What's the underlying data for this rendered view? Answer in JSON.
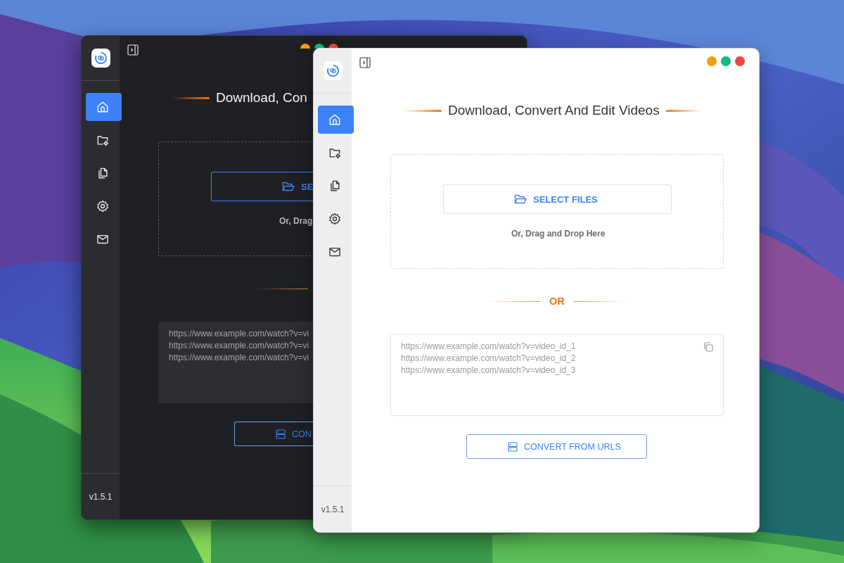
{
  "windows": [
    {
      "dark": true,
      "controls": [
        {
          "color": "#f59e0b"
        },
        {
          "color": "#10b981"
        },
        {
          "color": "#ef4444"
        }
      ],
      "sidebar": {
        "items": [
          {
            "kind": "home",
            "selected": true
          },
          {
            "kind": "folder-settings",
            "selected": false
          },
          {
            "kind": "files",
            "selected": false
          },
          {
            "kind": "settings",
            "selected": false
          },
          {
            "kind": "mail",
            "selected": false
          }
        ],
        "version": "v1.5.1"
      },
      "heading": "Download, Con",
      "select_button": "SE",
      "drop_hint": "Or, Drag",
      "urls": [
        "https://www.example.com/watch?v=vi",
        "https://www.example.com/watch?v=vi",
        "https://www.example.com/watch?v=vi"
      ],
      "convert_button": "CON"
    },
    {
      "dark": false,
      "controls": [
        {
          "color": "#f59e0b"
        },
        {
          "color": "#10b981"
        },
        {
          "color": "#ef4444"
        }
      ],
      "sidebar": {
        "items": [
          {
            "kind": "home",
            "selected": true
          },
          {
            "kind": "folder-settings",
            "selected": false
          },
          {
            "kind": "files",
            "selected": false
          },
          {
            "kind": "settings",
            "selected": false
          },
          {
            "kind": "mail",
            "selected": false
          }
        ],
        "version": "v1.5.1"
      },
      "heading": "Download, Convert And Edit Videos",
      "select_button": "SELECT FILES",
      "drop_hint": "Or, Drag and Drop Here",
      "or_label": "OR",
      "urls": [
        "https://www.example.com/watch?v=video_id_1",
        "https://www.example.com/watch?v=video_id_2",
        "https://www.example.com/watch?v=video_id_3"
      ],
      "convert_button": "CONVERT FROM URLS"
    }
  ]
}
